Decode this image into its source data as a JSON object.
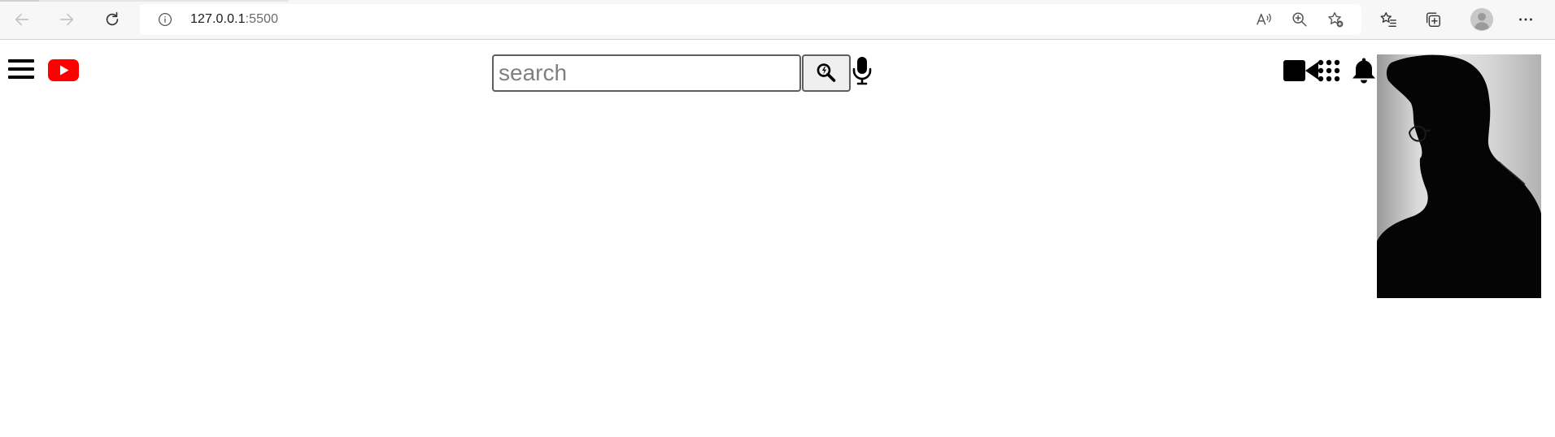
{
  "browser": {
    "url_host": "127.0.0.1",
    "url_port": ":5500",
    "icons": [
      "back-icon",
      "forward-icon",
      "refresh-icon",
      "info-icon",
      "read-aloud-icon",
      "zoom-icon",
      "add-favorite-icon",
      "favorites-icon",
      "collections-icon",
      "profile-icon",
      "more-icon"
    ]
  },
  "header": {
    "icons": [
      "menu-icon",
      "youtube-logo",
      "search-icon",
      "mic-icon",
      "video-camera-icon",
      "apps-grid-icon",
      "notifications-bell-icon"
    ],
    "logo_color": "#ff0000"
  },
  "search": {
    "placeholder": "search",
    "value": ""
  },
  "avatar": {
    "kind": "silhouette-photo"
  }
}
